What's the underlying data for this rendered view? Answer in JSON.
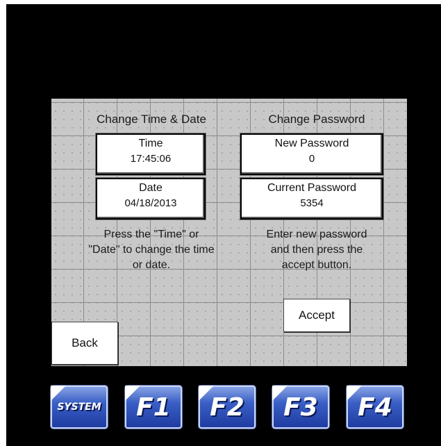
{
  "time_date": {
    "heading": "Change Time & Date",
    "time_label": "Time",
    "time_value": "17:45:06",
    "date_label": "Date",
    "date_value": "04/18/2013",
    "instructions_line1": "Press the \"Time\" or",
    "instructions_line2": "\"Date\" to change the time",
    "instructions_line3": "or date."
  },
  "password": {
    "heading": "Change Password",
    "new_label": "New Password",
    "new_value": "0",
    "current_label": "Current Password",
    "current_value": "5354",
    "instructions_line1": "Enter new password",
    "instructions_line2": "and then press the",
    "instructions_line3": "accept button.",
    "accept_label": "Accept"
  },
  "back_label": "Back",
  "function_keys": [
    "SYSTEM",
    "F1",
    "F2",
    "F3",
    "F4"
  ],
  "colors": {
    "background": "#000000",
    "panel": "#c8c8c8",
    "key_blue": "#2b4fb8"
  }
}
